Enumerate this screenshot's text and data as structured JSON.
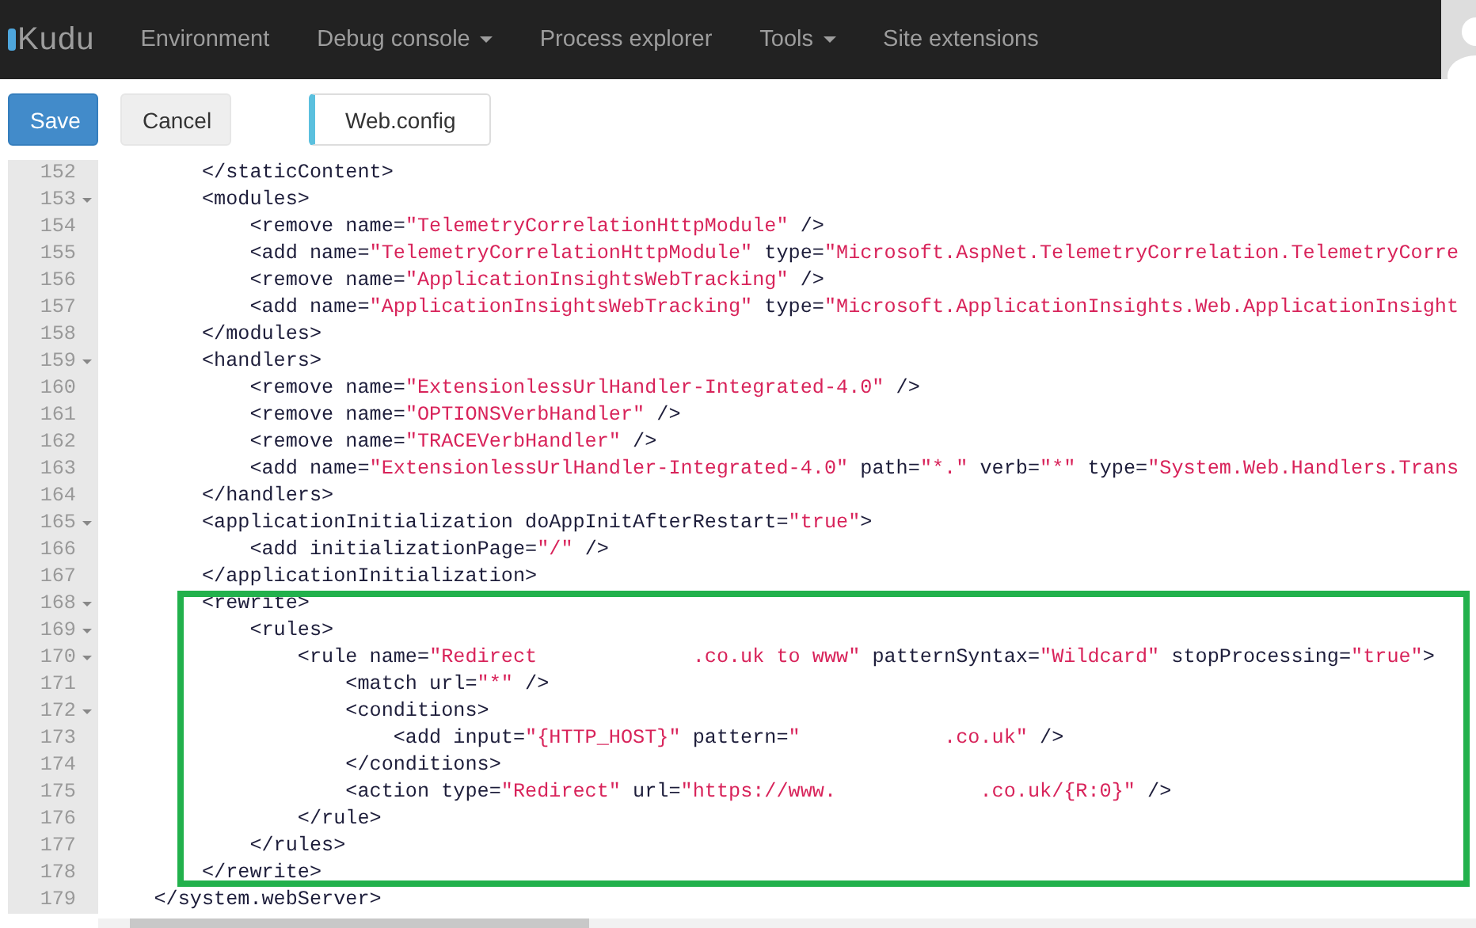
{
  "navbar": {
    "brand": "Kudu",
    "items": [
      {
        "label": "Environment",
        "dropdown": false
      },
      {
        "label": "Debug console",
        "dropdown": true
      },
      {
        "label": "Process explorer",
        "dropdown": false
      },
      {
        "label": "Tools",
        "dropdown": true
      },
      {
        "label": "Site extensions",
        "dropdown": false
      }
    ]
  },
  "toolbar": {
    "buttons": [
      {
        "label": "Save",
        "kind": "primary"
      },
      {
        "label": "Cancel",
        "kind": "default"
      }
    ],
    "file_tab": {
      "label": "Web.config"
    }
  },
  "editor": {
    "lines": [
      {
        "number": "152",
        "foldable": false,
        "highlighted": false,
        "segments": [
          {
            "kind": "markup",
            "text": "        </staticContent>"
          }
        ]
      },
      {
        "number": "153",
        "foldable": true,
        "highlighted": false,
        "segments": [
          {
            "kind": "markup",
            "text": "        <modules>"
          }
        ]
      },
      {
        "number": "154",
        "foldable": false,
        "highlighted": false,
        "segments": [
          {
            "kind": "markup",
            "text": "            <remove name="
          },
          {
            "kind": "string",
            "text": "\"TelemetryCorrelationHttpModule\""
          },
          {
            "kind": "markup",
            "text": " />"
          }
        ]
      },
      {
        "number": "155",
        "foldable": false,
        "highlighted": false,
        "segments": [
          {
            "kind": "markup",
            "text": "            <add name="
          },
          {
            "kind": "string",
            "text": "\"TelemetryCorrelationHttpModule\""
          },
          {
            "kind": "markup",
            "text": " type="
          },
          {
            "kind": "string",
            "text": "\"Microsoft.AspNet.TelemetryCorrelation.TelemetryCorre"
          }
        ]
      },
      {
        "number": "156",
        "foldable": false,
        "highlighted": false,
        "segments": [
          {
            "kind": "markup",
            "text": "            <remove name="
          },
          {
            "kind": "string",
            "text": "\"ApplicationInsightsWebTracking\""
          },
          {
            "kind": "markup",
            "text": " />"
          }
        ]
      },
      {
        "number": "157",
        "foldable": false,
        "highlighted": false,
        "segments": [
          {
            "kind": "markup",
            "text": "            <add name="
          },
          {
            "kind": "string",
            "text": "\"ApplicationInsightsWebTracking\""
          },
          {
            "kind": "markup",
            "text": " type="
          },
          {
            "kind": "string",
            "text": "\"Microsoft.ApplicationInsights.Web.ApplicationInsight"
          }
        ]
      },
      {
        "number": "158",
        "foldable": false,
        "highlighted": false,
        "segments": [
          {
            "kind": "markup",
            "text": "        </modules>"
          }
        ]
      },
      {
        "number": "159",
        "foldable": true,
        "highlighted": false,
        "segments": [
          {
            "kind": "markup",
            "text": "        <handlers>"
          }
        ]
      },
      {
        "number": "160",
        "foldable": false,
        "highlighted": false,
        "segments": [
          {
            "kind": "markup",
            "text": "            <remove name="
          },
          {
            "kind": "string",
            "text": "\"ExtensionlessUrlHandler-Integrated-4.0\""
          },
          {
            "kind": "markup",
            "text": " />"
          }
        ]
      },
      {
        "number": "161",
        "foldable": false,
        "highlighted": false,
        "segments": [
          {
            "kind": "markup",
            "text": "            <remove name="
          },
          {
            "kind": "string",
            "text": "\"OPTIONSVerbHandler\""
          },
          {
            "kind": "markup",
            "text": " />"
          }
        ]
      },
      {
        "number": "162",
        "foldable": false,
        "highlighted": false,
        "segments": [
          {
            "kind": "markup",
            "text": "            <remove name="
          },
          {
            "kind": "string",
            "text": "\"TRACEVerbHandler\""
          },
          {
            "kind": "markup",
            "text": " />"
          }
        ]
      },
      {
        "number": "163",
        "foldable": false,
        "highlighted": false,
        "segments": [
          {
            "kind": "markup",
            "text": "            <add name="
          },
          {
            "kind": "string",
            "text": "\"ExtensionlessUrlHandler-Integrated-4.0\""
          },
          {
            "kind": "markup",
            "text": " path="
          },
          {
            "kind": "string",
            "text": "\"*.\""
          },
          {
            "kind": "markup",
            "text": " verb="
          },
          {
            "kind": "string",
            "text": "\"*\""
          },
          {
            "kind": "markup",
            "text": " type="
          },
          {
            "kind": "string",
            "text": "\"System.Web.Handlers.Trans"
          }
        ]
      },
      {
        "number": "164",
        "foldable": false,
        "highlighted": false,
        "segments": [
          {
            "kind": "markup",
            "text": "        </handlers>"
          }
        ]
      },
      {
        "number": "165",
        "foldable": true,
        "highlighted": false,
        "segments": [
          {
            "kind": "markup",
            "text": "        <applicationInitialization doAppInitAfterRestart="
          },
          {
            "kind": "string",
            "text": "\"true\""
          },
          {
            "kind": "markup",
            "text": ">"
          }
        ]
      },
      {
        "number": "166",
        "foldable": false,
        "highlighted": false,
        "segments": [
          {
            "kind": "markup",
            "text": "            <add initializationPage="
          },
          {
            "kind": "string",
            "text": "\"/\""
          },
          {
            "kind": "markup",
            "text": " />"
          }
        ]
      },
      {
        "number": "167",
        "foldable": false,
        "highlighted": false,
        "segments": [
          {
            "kind": "markup",
            "text": "        </applicationInitialization>"
          }
        ]
      },
      {
        "number": "168",
        "foldable": true,
        "highlighted": true,
        "segments": [
          {
            "kind": "markup",
            "text": "        <rewrite>"
          }
        ]
      },
      {
        "number": "169",
        "foldable": true,
        "highlighted": true,
        "segments": [
          {
            "kind": "markup",
            "text": "            <rules>"
          }
        ]
      },
      {
        "number": "170",
        "foldable": true,
        "highlighted": true,
        "segments": [
          {
            "kind": "markup",
            "text": "                <rule name="
          },
          {
            "kind": "string",
            "text": "\"Redirect             .co.uk to www\""
          },
          {
            "kind": "markup",
            "text": " patternSyntax="
          },
          {
            "kind": "string",
            "text": "\"Wildcard\""
          },
          {
            "kind": "markup",
            "text": " stopProcessing="
          },
          {
            "kind": "string",
            "text": "\"true\""
          },
          {
            "kind": "markup",
            "text": ">"
          }
        ]
      },
      {
        "number": "171",
        "foldable": false,
        "highlighted": true,
        "segments": [
          {
            "kind": "markup",
            "text": "                    <match url="
          },
          {
            "kind": "string",
            "text": "\"*\""
          },
          {
            "kind": "markup",
            "text": " />"
          }
        ]
      },
      {
        "number": "172",
        "foldable": true,
        "highlighted": true,
        "segments": [
          {
            "kind": "markup",
            "text": "                    <conditions>"
          }
        ]
      },
      {
        "number": "173",
        "foldable": false,
        "highlighted": true,
        "segments": [
          {
            "kind": "markup",
            "text": "                        <add input="
          },
          {
            "kind": "string",
            "text": "\"{HTTP_HOST}\""
          },
          {
            "kind": "markup",
            "text": " pattern="
          },
          {
            "kind": "string",
            "text": "\"            .co.uk\""
          },
          {
            "kind": "markup",
            "text": " />"
          }
        ]
      },
      {
        "number": "174",
        "foldable": false,
        "highlighted": true,
        "segments": [
          {
            "kind": "markup",
            "text": "                    </conditions>"
          }
        ]
      },
      {
        "number": "175",
        "foldable": false,
        "highlighted": true,
        "segments": [
          {
            "kind": "markup",
            "text": "                    <action type="
          },
          {
            "kind": "string",
            "text": "\"Redirect\""
          },
          {
            "kind": "markup",
            "text": " url="
          },
          {
            "kind": "string",
            "text": "\"https://www.            .co.uk/{R:0}\""
          },
          {
            "kind": "markup",
            "text": " />"
          }
        ]
      },
      {
        "number": "176",
        "foldable": false,
        "highlighted": true,
        "segments": [
          {
            "kind": "markup",
            "text": "                </rule>"
          }
        ]
      },
      {
        "number": "177",
        "foldable": false,
        "highlighted": true,
        "segments": [
          {
            "kind": "markup",
            "text": "            </rules>"
          }
        ]
      },
      {
        "number": "178",
        "foldable": false,
        "highlighted": true,
        "segments": [
          {
            "kind": "markup",
            "text": "        </rewrite>"
          }
        ]
      },
      {
        "number": "179",
        "foldable": false,
        "highlighted": false,
        "segments": [
          {
            "kind": "markup",
            "text": "    </system.webServer>"
          }
        ]
      }
    ]
  }
}
